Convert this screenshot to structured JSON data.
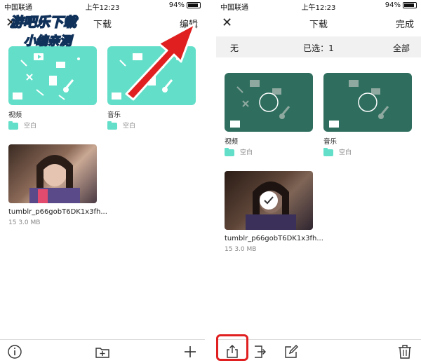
{
  "left_screen": {
    "status": {
      "carrier": "中国联通",
      "time": "上午12:23",
      "battery": "94%"
    },
    "nav": {
      "title": "下载",
      "right_button": "编辑"
    },
    "folders": [
      {
        "name": "视频",
        "subtitle": "空白"
      },
      {
        "name": "音乐",
        "subtitle": "空白"
      }
    ],
    "file": {
      "name": "tumblr_p66gobT6DK1x3fh...",
      "meta": "15  3.0 MB"
    },
    "watermark": {
      "line1": "游吧乐下载",
      "line2": "小编亲测"
    },
    "toolbar_icons": [
      "info-icon",
      "add-folder-icon",
      "plus-icon"
    ]
  },
  "right_screen": {
    "status": {
      "carrier": "中国联通",
      "time": "上午12:23",
      "battery": "94%"
    },
    "nav": {
      "title": "下载",
      "right_button": "完成"
    },
    "selection_bar": {
      "none": "无",
      "selected": "已选：1",
      "all": "全部"
    },
    "folders": [
      {
        "name": "视频",
        "subtitle": "空白"
      },
      {
        "name": "音乐",
        "subtitle": "空白"
      }
    ],
    "file": {
      "name": "tumblr_p66gobT6DK1x3fh...",
      "meta": "15  3.0 MB"
    },
    "toolbar_icons": [
      "share-icon",
      "move-icon",
      "edit-icon",
      "trash-icon"
    ]
  },
  "colors": {
    "folder_teal": "#63dfc9",
    "folder_dark": "#2f6e5e",
    "highlight_red": "#e02020"
  }
}
